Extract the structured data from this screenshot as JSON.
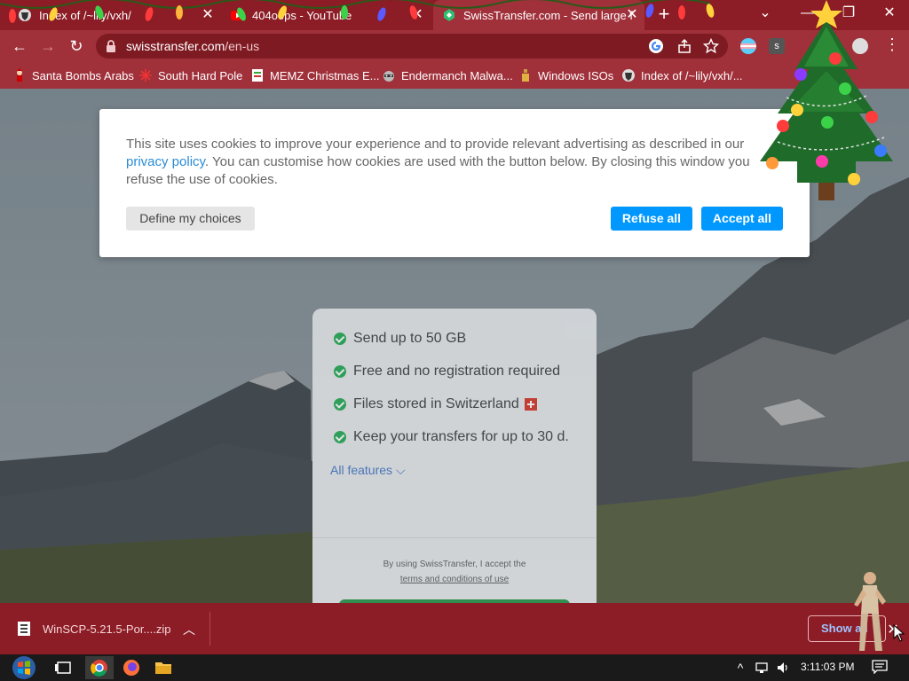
{
  "browser": {
    "tabs": [
      {
        "title": "Index of /~lily/vxh/",
        "active": false,
        "favicon": "globe-shield-icon"
      },
      {
        "title": "404oops - YouTube",
        "active": false,
        "favicon": "youtube-icon"
      },
      {
        "title": "SwissTransfer.com - Send large f",
        "active": true,
        "favicon": "swisstransfer-icon"
      }
    ],
    "new_tab": "+",
    "url_domain": "swisstransfer.com",
    "url_path": "/en-us",
    "accent": "#a0303a"
  },
  "bookmarks": [
    {
      "label": "Santa Bombs Arabs",
      "icon": "santa-icon"
    },
    {
      "label": "South Hard Pole",
      "icon": "snowflake-icon"
    },
    {
      "label": "MEMZ Christmas E...",
      "icon": "file-icon"
    },
    {
      "label": "Endermanch Malwa...",
      "icon": "raccoon-icon"
    },
    {
      "label": "Windows ISOs",
      "icon": "bottle-icon"
    },
    {
      "label": "Index of /~lily/vxh/...",
      "icon": "globe-shield-icon"
    }
  ],
  "cookie_dialog": {
    "text_before_link": "This site uses cookies to improve your experience and to provide relevant advertising as described in our ",
    "link_text": "privacy policy",
    "text_after_link": ". You can customise how cookies are used with the button below. By closing this window you refuse the use of cookies.",
    "define_label": "Define my choices",
    "refuse_label": "Refuse all",
    "accept_label": "Accept all",
    "button_color": "#0098ff"
  },
  "features": {
    "items": [
      {
        "text": "Send up to 50 GB"
      },
      {
        "text": "Free and no registration required"
      },
      {
        "text": "Files stored in Switzerland",
        "flag": true
      },
      {
        "text": "Keep your transfers for up to 30 d."
      }
    ],
    "all_features": "All features",
    "terms_line1": "By using SwissTransfer, I accept the",
    "terms_link": "terms and conditions of use"
  },
  "download_bar": {
    "file_name": "WinSCP-5.21.5-Por....zip",
    "show_all": "Show all"
  },
  "taskbar": {
    "time": "3:11:03 PM"
  }
}
